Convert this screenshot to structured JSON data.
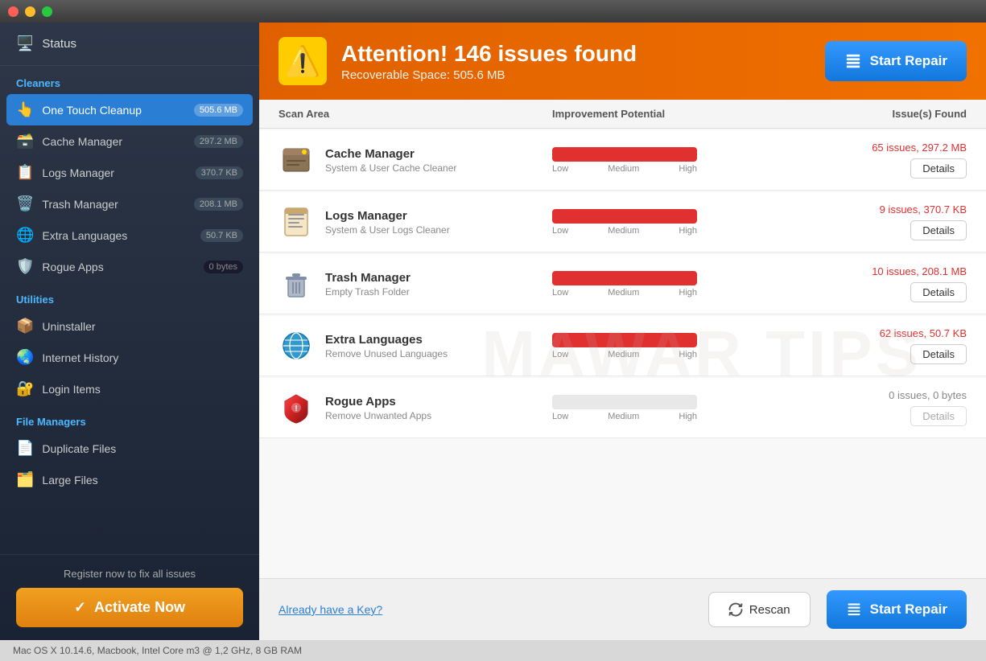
{
  "titleBar": {
    "buttons": [
      "close",
      "minimize",
      "maximize"
    ]
  },
  "sidebar": {
    "status": {
      "label": "Status",
      "icon": "monitor"
    },
    "sections": [
      {
        "label": "Cleaners",
        "items": [
          {
            "id": "one-touch-cleanup",
            "label": "One Touch Cleanup",
            "badge": "505.6 MB",
            "active": true,
            "icon": "hand"
          },
          {
            "id": "cache-manager",
            "label": "Cache Manager",
            "badge": "297.2 MB",
            "active": false,
            "icon": "cache"
          },
          {
            "id": "logs-manager",
            "label": "Logs Manager",
            "badge": "370.7 KB",
            "active": false,
            "icon": "logs"
          },
          {
            "id": "trash-manager",
            "label": "Trash Manager",
            "badge": "208.1 MB",
            "active": false,
            "icon": "trash"
          },
          {
            "id": "extra-languages",
            "label": "Extra Languages",
            "badge": "50.7 KB",
            "active": false,
            "icon": "globe"
          },
          {
            "id": "rogue-apps",
            "label": "Rogue Apps",
            "badge": "0 bytes",
            "active": false,
            "icon": "shield",
            "badgeDark": true
          }
        ]
      },
      {
        "label": "Utilities",
        "items": [
          {
            "id": "uninstaller",
            "label": "Uninstaller",
            "badge": "",
            "active": false,
            "icon": "box"
          },
          {
            "id": "internet-history",
            "label": "Internet History",
            "badge": "",
            "active": false,
            "icon": "globe2"
          },
          {
            "id": "login-items",
            "label": "Login Items",
            "badge": "",
            "active": false,
            "icon": "login"
          }
        ]
      },
      {
        "label": "File Managers",
        "items": [
          {
            "id": "duplicate-files",
            "label": "Duplicate Files",
            "badge": "",
            "active": false,
            "icon": "duplicate"
          },
          {
            "id": "large-files",
            "label": "Large Files",
            "badge": "",
            "active": false,
            "icon": "large-files"
          }
        ]
      }
    ],
    "footer": {
      "registerText": "Register now to fix all issues",
      "activateLabel": "Activate Now"
    }
  },
  "main": {
    "banner": {
      "title": "Attention! 146 issues found",
      "subtitle": "Recoverable Space: 505.6 MB",
      "startRepairLabel": "Start Repair"
    },
    "tableHeaders": {
      "scanArea": "Scan Area",
      "improvementPotential": "Improvement Potential",
      "issuesFound": "Issue(s) Found"
    },
    "scanItems": [
      {
        "id": "cache-manager",
        "name": "Cache Manager",
        "desc": "System & User Cache Cleaner",
        "issuesText": "65 issues, 297.2 MB",
        "detailsLabel": "Details",
        "barFull": true,
        "icon": "🗃️"
      },
      {
        "id": "logs-manager",
        "name": "Logs Manager",
        "desc": "System & User Logs Cleaner",
        "issuesText": "9 issues, 370.7 KB",
        "detailsLabel": "Details",
        "barFull": true,
        "icon": "📋"
      },
      {
        "id": "trash-manager",
        "name": "Trash Manager",
        "desc": "Empty Trash Folder",
        "issuesText": "10 issues, 208.1 MB",
        "detailsLabel": "Details",
        "barFull": true,
        "icon": "🗑️"
      },
      {
        "id": "extra-languages",
        "name": "Extra Languages",
        "desc": "Remove Unused Languages",
        "issuesText": "62 issues, 50.7 KB",
        "detailsLabel": "Details",
        "barFull": true,
        "icon": "🌐"
      },
      {
        "id": "rogue-apps",
        "name": "Rogue Apps",
        "desc": "Remove Unwanted Apps",
        "issuesText": "0 issues, 0 bytes",
        "detailsLabel": "Details",
        "barFull": false,
        "icon": "🛡️"
      }
    ],
    "footer": {
      "alreadyKeyLabel": "Already have a Key?",
      "rescanLabel": "Rescan",
      "startRepairLabel": "Start Repair"
    }
  },
  "statusBar": {
    "text": "Mac OS X 10.14.6, Macbook, Intel Core m3 @ 1,2 GHz, 8 GB RAM"
  }
}
